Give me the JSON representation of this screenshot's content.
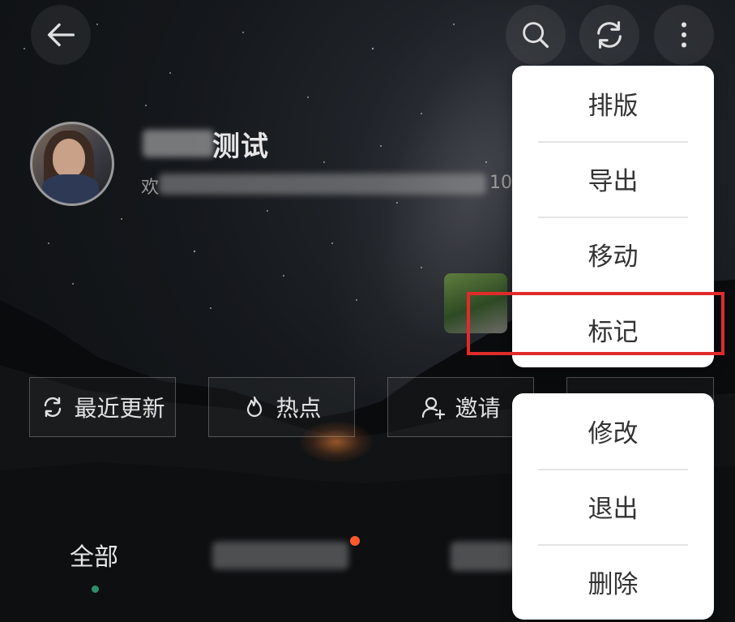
{
  "header": {
    "back_icon": "arrow-left-icon",
    "search_icon": "search-icon",
    "refresh_icon": "refresh-icon",
    "more_icon": "more-vertical-icon"
  },
  "group": {
    "name_visible": "测试",
    "sub_visible_prefix": "欢",
    "sub_visible_suffix": "10"
  },
  "actions": [
    {
      "label": "最近更新",
      "icon": "sync-icon"
    },
    {
      "label": "热点",
      "icon": "flame-icon"
    },
    {
      "label": "邀请",
      "icon": "add-user-icon"
    }
  ],
  "tabs": [
    {
      "label": "全部",
      "active": true
    }
  ],
  "menu_top": [
    "排版",
    "导出",
    "移动",
    "标记"
  ],
  "menu_bottom": [
    "修改",
    "退出",
    "删除"
  ],
  "colors": {
    "highlight": "#e02b2b",
    "active_dot": "#2f8f6a",
    "badge": "#ff5a2c"
  }
}
